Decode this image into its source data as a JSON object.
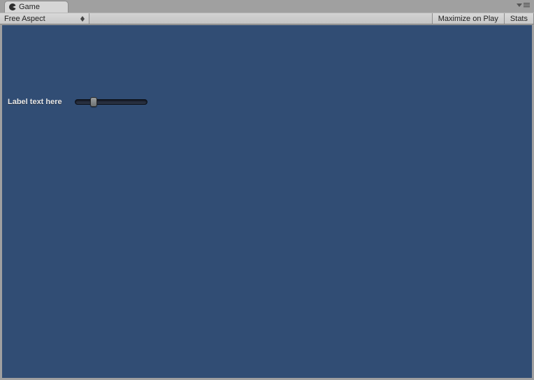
{
  "tab": {
    "title": "Game"
  },
  "toolbar": {
    "aspect_dropdown": {
      "selected": "Free Aspect"
    },
    "maximize_label": "Maximize on Play",
    "stats_label": "Stats"
  },
  "gui": {
    "label_text": "Label text here",
    "slider_value": 0.25,
    "slider_min": 0,
    "slider_max": 1
  }
}
